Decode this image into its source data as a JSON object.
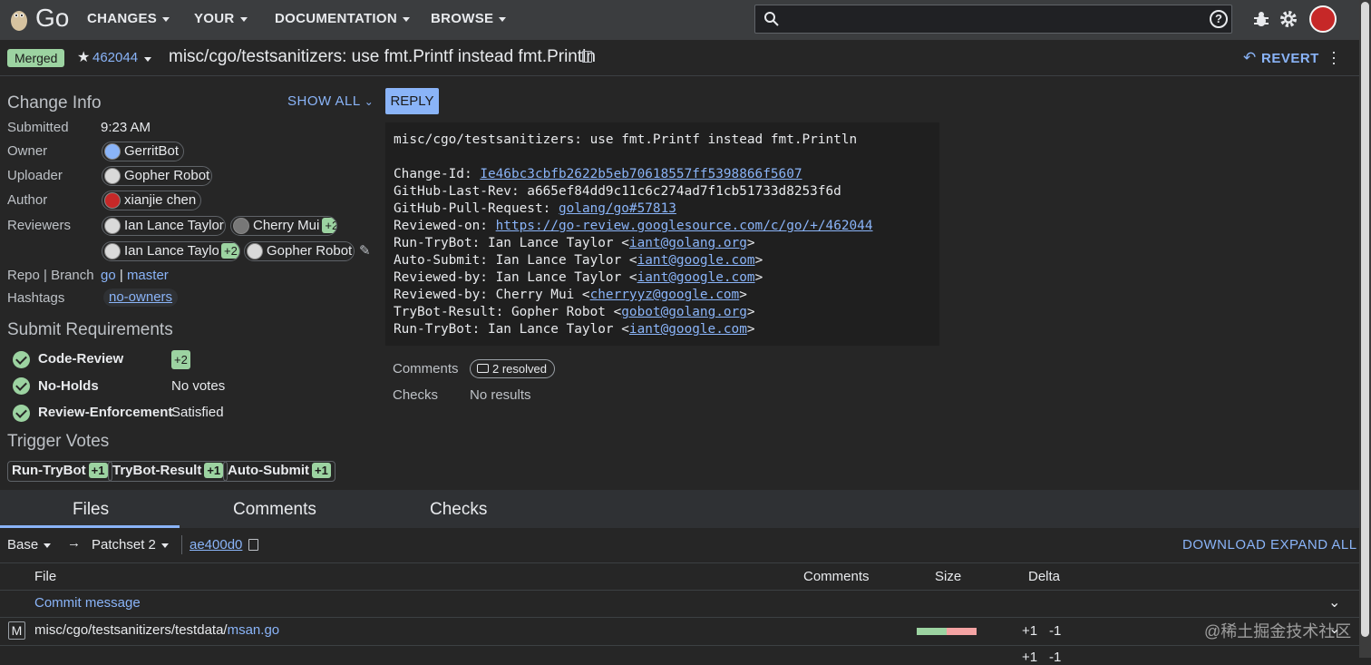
{
  "app": {
    "logo_text": "Go"
  },
  "nav": {
    "items": [
      "CHANGES",
      "YOUR",
      "DOCUMENTATION",
      "BROWSE"
    ]
  },
  "search": {
    "placeholder": ""
  },
  "header": {
    "status": "Merged",
    "change_number": "462044",
    "subject": "misc/cgo/testsanitizers: use fmt.Printf instead fmt.Println",
    "revert_label": "REVERT"
  },
  "change_info": {
    "title": "Change Info",
    "show_all": "SHOW ALL",
    "rows": {
      "submitted": {
        "label": "Submitted",
        "value": "9:23 AM"
      },
      "owner": {
        "label": "Owner",
        "value": "GerritBot"
      },
      "uploader": {
        "label": "Uploader",
        "value": "Gopher Robot"
      },
      "author": {
        "label": "Author",
        "value": "xianjie chen"
      },
      "reviewers": {
        "label": "Reviewers",
        "items": [
          "Ian Lance Taylor",
          "Cherry Mui",
          "Ian Lance Taylor",
          "Gopher Robot"
        ],
        "votes": [
          "+2",
          "+2"
        ]
      },
      "repo": {
        "label": "Repo | Branch",
        "repo": "go",
        "sep": "|",
        "branch": "master"
      },
      "hashtags": {
        "label": "Hashtags",
        "value": "no-owners"
      }
    }
  },
  "submit_requirements": {
    "title": "Submit Requirements",
    "items": [
      {
        "name": "Code-Review",
        "value": "+2"
      },
      {
        "name": "No-Holds",
        "value": "No votes"
      },
      {
        "name": "Review-Enforcement",
        "value": "Satisfied"
      }
    ]
  },
  "trigger_votes": {
    "title": "Trigger Votes",
    "items": [
      {
        "name": "Run-TryBot",
        "vote": "+1"
      },
      {
        "name": "TryBot-Result",
        "vote": "+1"
      },
      {
        "name": "Auto-Submit",
        "vote": "+1"
      }
    ]
  },
  "reply_label": "REPLY",
  "commit_message": {
    "l1": "misc/cgo/testsanitizers: use fmt.Printf instead fmt.Println",
    "change_id_label": "Change-Id: ",
    "change_id": "Ie46bc3cbfb2622b5eb70618557ff5398866f5607",
    "l3": "GitHub-Last-Rev: a665ef84dd9c11c6c274ad7f1cb51733d8253f6d",
    "l4_label": "GitHub-Pull-Request: ",
    "l4_link": "golang/go#57813",
    "l5_label": "Reviewed-on: ",
    "l5_link": "https://go-review.googlesource.com/c/go/+/462044",
    "l6_pre": "Run-TryBot: Ian Lance Taylor <",
    "l6_link": "iant@golang.org",
    "l7_pre": "Auto-Submit: Ian Lance Taylor <",
    "l7_link": "iant@google.com",
    "l8_pre": "Reviewed-by: Ian Lance Taylor <",
    "l8_link": "iant@google.com",
    "l9_pre": "Reviewed-by: Cherry Mui <",
    "l9_link": "cherryyz@google.com",
    "l10_pre": "TryBot-Result: Gopher Robot <",
    "l10_link": "gobot@golang.org",
    "l11_pre": "Run-TryBot: Ian Lance Taylor <",
    "l11_link": "iant@google.com",
    "gt": ">"
  },
  "summary": {
    "comments_label": "Comments",
    "comments_value": "2 resolved",
    "checks_label": "Checks",
    "checks_value": "No results"
  },
  "tabs": [
    "Files",
    "Comments",
    "Checks"
  ],
  "files_toolbar": {
    "base": "Base",
    "arrow": "→",
    "patchset": "Patchset 2",
    "commit": "ae400d0",
    "download": "DOWNLOAD",
    "expand_all": "EXPAND ALL"
  },
  "files_table": {
    "headers": {
      "file": "File",
      "comments": "Comments",
      "size": "Size",
      "delta": "Delta"
    },
    "commit_message_row": "Commit message",
    "rows": [
      {
        "status": "M",
        "path_prefix": "misc/cgo/testsanitizers/testdata/",
        "file": "msan.go",
        "added": "+1",
        "removed": "-1",
        "added_fraction": 0.5
      }
    ],
    "partial_row": {
      "added": "+1",
      "removed": "-1"
    }
  },
  "watermark": "@稀土掘金技术社区",
  "colors": {
    "merged": "#9cd3a1",
    "link": "#8ab4f8",
    "added": "#9cd3a1",
    "removed": "#f4a3a3"
  }
}
